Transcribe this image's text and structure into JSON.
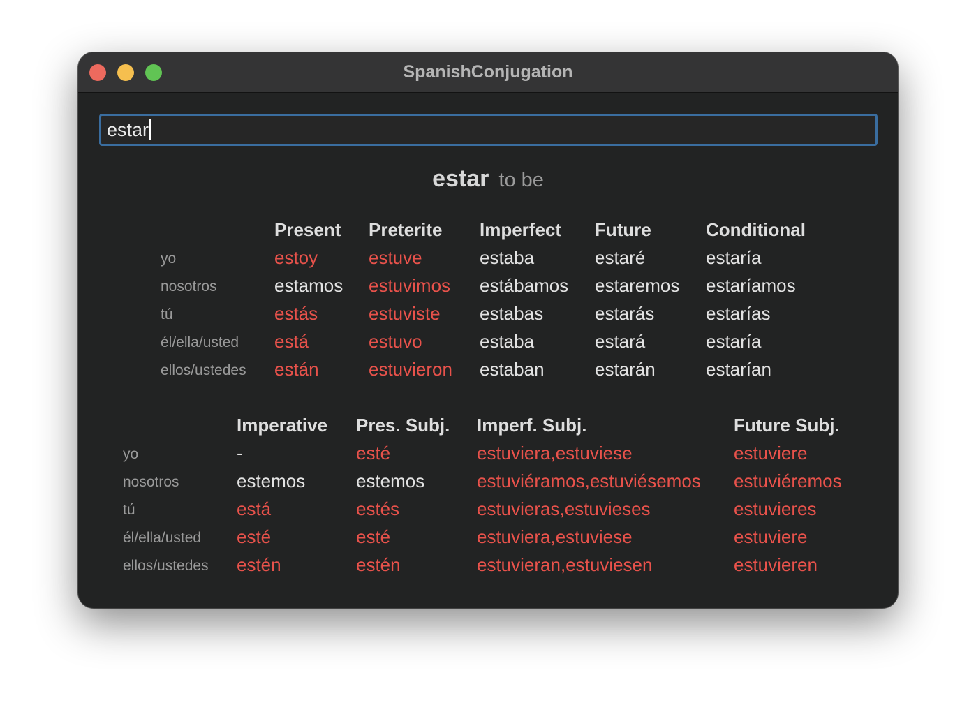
{
  "window": {
    "title": "SpanishConjugation"
  },
  "search": {
    "value": "estar"
  },
  "verb": {
    "infinitive": "estar",
    "translation": "to be"
  },
  "colors": {
    "irregular": "#e8524b",
    "regular": "#e2e2e2",
    "focus_ring": "#3a6d9f"
  },
  "table1": {
    "headers": [
      "Present",
      "Preterite",
      "Imperfect",
      "Future",
      "Conditional"
    ],
    "pronouns": [
      "yo",
      "nosotros",
      "tú",
      "él/ella/usted",
      "ellos/ustedes"
    ],
    "rows": [
      [
        {
          "text": "estoy",
          "irregular": true
        },
        {
          "text": "estuve",
          "irregular": true
        },
        {
          "text": "estaba",
          "irregular": false
        },
        {
          "text": "estaré",
          "irregular": false
        },
        {
          "text": "estaría",
          "irregular": false
        }
      ],
      [
        {
          "text": "estamos",
          "irregular": false
        },
        {
          "text": "estuvimos",
          "irregular": true
        },
        {
          "text": "estábamos",
          "irregular": false
        },
        {
          "text": "estaremos",
          "irregular": false
        },
        {
          "text": "estaríamos",
          "irregular": false
        }
      ],
      [
        {
          "text": "estás",
          "irregular": true
        },
        {
          "text": "estuviste",
          "irregular": true
        },
        {
          "text": "estabas",
          "irregular": false
        },
        {
          "text": "estarás",
          "irregular": false
        },
        {
          "text": "estarías",
          "irregular": false
        }
      ],
      [
        {
          "text": "está",
          "irregular": true
        },
        {
          "text": "estuvo",
          "irregular": true
        },
        {
          "text": "estaba",
          "irregular": false
        },
        {
          "text": "estará",
          "irregular": false
        },
        {
          "text": "estaría",
          "irregular": false
        }
      ],
      [
        {
          "text": "están",
          "irregular": true
        },
        {
          "text": "estuvieron",
          "irregular": true
        },
        {
          "text": "estaban",
          "irregular": false
        },
        {
          "text": "estarán",
          "irregular": false
        },
        {
          "text": "estarían",
          "irregular": false
        }
      ]
    ]
  },
  "table2": {
    "headers": [
      "Imperative",
      "Pres. Subj.",
      "Imperf. Subj.",
      "Future Subj."
    ],
    "pronouns": [
      "yo",
      "nosotros",
      "tú",
      "él/ella/usted",
      "ellos/ustedes"
    ],
    "rows": [
      [
        {
          "text": "-",
          "irregular": false
        },
        {
          "text": "esté",
          "irregular": true
        },
        {
          "text": "estuviera,estuviese",
          "irregular": true
        },
        {
          "text": "estuviere",
          "irregular": true
        }
      ],
      [
        {
          "text": "estemos",
          "irregular": false
        },
        {
          "text": "estemos",
          "irregular": false
        },
        {
          "text": "estuviéramos,estuviésemos",
          "irregular": true
        },
        {
          "text": "estuviéremos",
          "irregular": true
        }
      ],
      [
        {
          "text": "está",
          "irregular": true
        },
        {
          "text": "estés",
          "irregular": true
        },
        {
          "text": "estuvieras,estuvieses",
          "irregular": true
        },
        {
          "text": "estuvieres",
          "irregular": true
        }
      ],
      [
        {
          "text": "esté",
          "irregular": true
        },
        {
          "text": "esté",
          "irregular": true
        },
        {
          "text": "estuviera,estuviese",
          "irregular": true
        },
        {
          "text": "estuviere",
          "irregular": true
        }
      ],
      [
        {
          "text": "estén",
          "irregular": true
        },
        {
          "text": "estén",
          "irregular": true
        },
        {
          "text": "estuvieran,estuviesen",
          "irregular": true
        },
        {
          "text": "estuvieren",
          "irregular": true
        }
      ]
    ]
  }
}
